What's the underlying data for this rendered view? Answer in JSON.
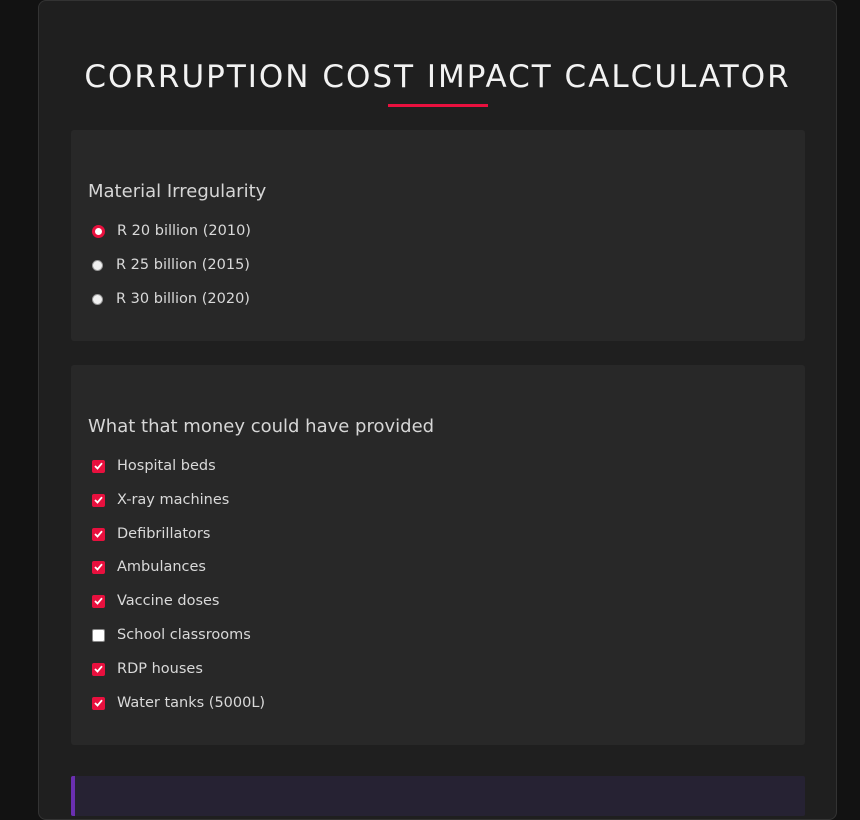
{
  "page": {
    "title": "CORRUPTION COST IMPACT CALCULATOR"
  },
  "irregularity": {
    "heading": "Material Irregularity",
    "options": [
      {
        "label": "R 20 billion (2010)",
        "selected": true
      },
      {
        "label": "R 25 billion (2015)",
        "selected": false
      },
      {
        "label": "R 30 billion (2020)",
        "selected": false
      }
    ]
  },
  "provisions": {
    "heading": "What that money could have provided",
    "items": [
      {
        "label": "Hospital beds",
        "checked": true
      },
      {
        "label": "X-ray machines",
        "checked": true
      },
      {
        "label": "Defibrillators",
        "checked": true
      },
      {
        "label": "Ambulances",
        "checked": true
      },
      {
        "label": "Vaccine doses",
        "checked": true
      },
      {
        "label": "School classrooms",
        "checked": false
      },
      {
        "label": "RDP houses",
        "checked": true
      },
      {
        "label": "Water tanks (5000L)",
        "checked": true
      }
    ]
  },
  "colors": {
    "accent": "#e8103e",
    "results_border": "#6a2fb0"
  }
}
